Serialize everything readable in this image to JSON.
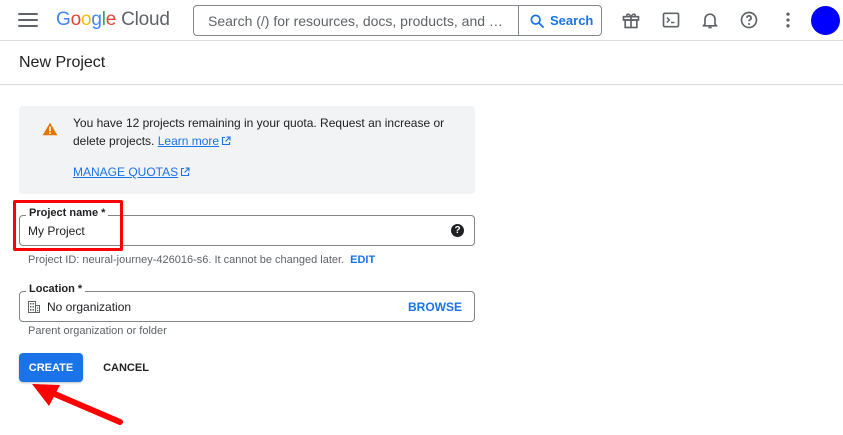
{
  "app": {
    "logo": {
      "google": "Google",
      "cloud": "Cloud"
    }
  },
  "search": {
    "placeholder": "Search (/) for resources, docs, products, and …",
    "button_label": "Search"
  },
  "toolbar_icons": [
    "menu-icon",
    "gift-icon",
    "terminal-icon",
    "bell-icon",
    "help-icon",
    "more-vert-icon"
  ],
  "colors": {
    "accent": "#1a73e8",
    "avatar": "#0000ff",
    "warning": "#e37400",
    "annotation": "#ff0000"
  },
  "page": {
    "title": "New Project"
  },
  "quota_banner": {
    "text": "You have 12 projects remaining in your quota. Request an increase or delete projects.",
    "learn_more": "Learn more",
    "manage_quotas": "MANAGE QUOTAS"
  },
  "form": {
    "project_name": {
      "label": "Project name *",
      "value": "My Project",
      "help_glyph": "?",
      "hint": "Project ID: neural-journey-426016-s6. It cannot be changed later.",
      "edit_label": "EDIT"
    },
    "location": {
      "label": "Location *",
      "value": "No organization",
      "browse_label": "BROWSE",
      "hint": "Parent organization or folder"
    }
  },
  "actions": {
    "create": "CREATE",
    "cancel": "CANCEL"
  }
}
